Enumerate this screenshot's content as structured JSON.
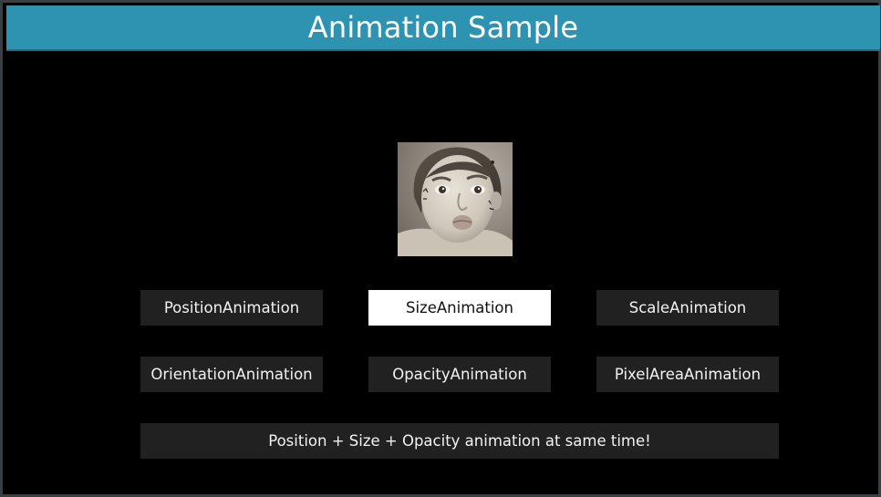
{
  "app": {
    "title": "Animation Sample"
  },
  "image": {
    "description_icon": "child-portrait-image"
  },
  "buttons": {
    "row1": [
      "PositionAnimation",
      "SizeAnimation",
      "ScaleAnimation"
    ],
    "row2": [
      "OrientationAnimation",
      "OpacityAnimation",
      "PixelAreaAnimation"
    ],
    "combined": "Position + Size + Opacity animation at same time!"
  },
  "selected_button": "SizeAnimation",
  "colors": {
    "title_bar": "#2d93b0",
    "background": "#000000",
    "button": "#212121",
    "button_selected": "#ffffff",
    "button_text": "#f2f2f2"
  }
}
